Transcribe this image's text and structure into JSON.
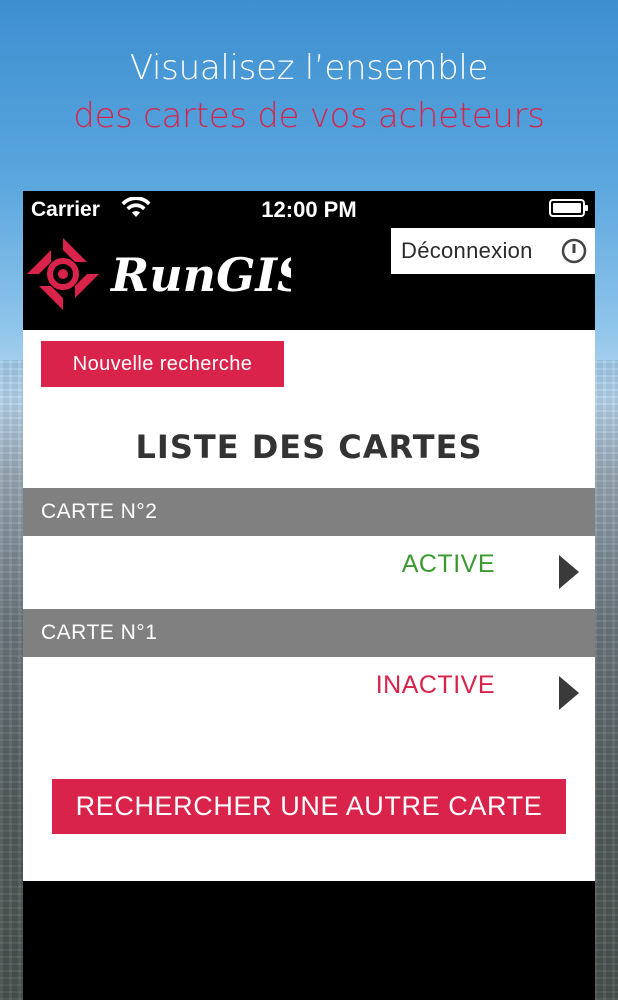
{
  "promo": {
    "line1": "Visualisez l’ensemble",
    "line2": "des cartes de vos acheteurs"
  },
  "statusbar": {
    "carrier": "Carrier",
    "time": "12:00 PM",
    "wifi_icon": "wifi-icon",
    "battery_icon": "battery-icon"
  },
  "header": {
    "logo_text": "RunGIS",
    "logout_label": "Déconnexion",
    "logout_icon": "power-icon"
  },
  "main": {
    "new_search_label": "Nouvelle recherche",
    "title": "LISTE DES CARTES",
    "cards": [
      {
        "label": "CARTE N°2",
        "status": "ACTIVE",
        "status_color": "#3a9a2f"
      },
      {
        "label": "CARTE N°1",
        "status": "INACTIVE",
        "status_color": "#d9234a"
      }
    ],
    "search_other_label": "RECHERCHER UNE AUTRE CARTE"
  },
  "colors": {
    "brand_red": "#d9234a",
    "header_gray": "#808080",
    "active_green": "#3a9a2f"
  }
}
